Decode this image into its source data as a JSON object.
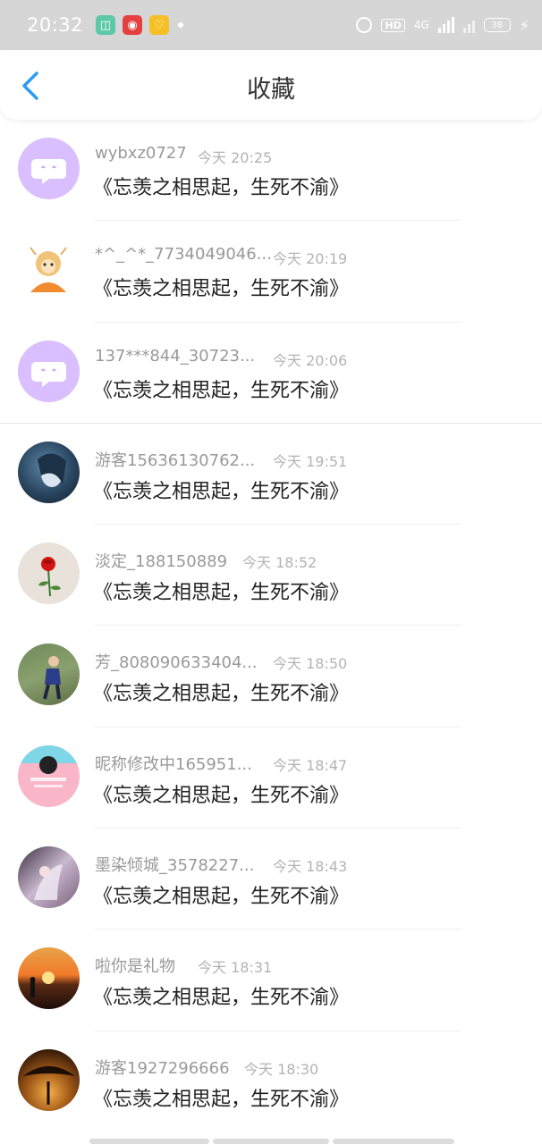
{
  "status_bar": {
    "time": "20:32",
    "hd_label": "HD",
    "network_label": "4G",
    "battery_level": "38"
  },
  "header": {
    "title": "收藏"
  },
  "favorites": [
    {
      "name": "wybxz0727",
      "time": "今天 20:25",
      "content": "《忘羡之相思起，生死不渝》",
      "avatar": "chat-bubble-avatar"
    },
    {
      "name": "*^_^*_7734049046...",
      "time": "今天 20:19",
      "content": "《忘羡之相思起，生死不渝》",
      "avatar": "cartoon-monkey-avatar"
    },
    {
      "name": "137***844_30723...",
      "time": "今天 20:06",
      "content": "《忘羡之相思起，生死不渝》",
      "avatar": "chat-bubble-avatar"
    },
    {
      "name": "游客15636130762...",
      "time": "今天 19:51",
      "content": "《忘羡之相思起，生死不渝》",
      "avatar": "anime-girl-avatar"
    },
    {
      "name": "淡定_188150889",
      "time": "今天 18:52",
      "content": "《忘羡之相思起，生死不渝》",
      "avatar": "red-rose-avatar"
    },
    {
      "name": "芳_808090633404...",
      "time": "今天 18:50",
      "content": "《忘羡之相思起，生死不渝》",
      "avatar": "child-photo-avatar"
    },
    {
      "name": "昵称修改中165951...",
      "time": "今天 18:47",
      "content": "《忘羡之相思起，生死不渝》",
      "avatar": "pink-poster-avatar"
    },
    {
      "name": "墨染倾城_3578227...",
      "time": "今天 18:43",
      "content": "《忘羡之相思起，生死不渝》",
      "avatar": "anime-illustration-avatar"
    },
    {
      "name": "啦你是礼物",
      "time": "今天 18:31",
      "content": "《忘羡之相思起，生死不渝》",
      "avatar": "sunset-avatar"
    },
    {
      "name": "游客1927296666",
      "time": "今天 18:30",
      "content": "《忘羡之相思起，生死不渝》",
      "avatar": "tree-sunset-avatar"
    }
  ],
  "colors": {
    "accent": "#2b9cf2",
    "chat_avatar_bg": "#d9bfff",
    "name_text": "#999999",
    "time_text": "#b3b3b3",
    "content_text": "#222222"
  }
}
